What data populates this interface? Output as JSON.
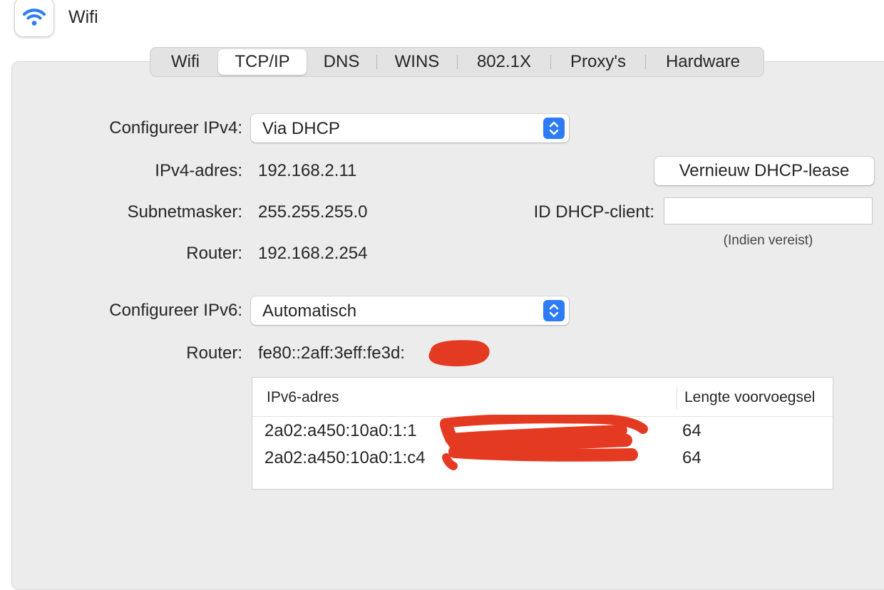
{
  "window": {
    "title": "Wifi",
    "icon": "wifi-icon"
  },
  "tabs": [
    {
      "label": "Wifi",
      "active": false
    },
    {
      "label": "TCP/IP",
      "active": true
    },
    {
      "label": "DNS",
      "active": false
    },
    {
      "label": "WINS",
      "active": false
    },
    {
      "label": "802.1X",
      "active": false
    },
    {
      "label": "Proxy's",
      "active": false
    },
    {
      "label": "Hardware",
      "active": false
    }
  ],
  "ipv4": {
    "configure_label": "Configureer IPv4:",
    "configure_value": "Via DHCP",
    "address_label": "IPv4-adres:",
    "address_value": "192.168.2.11",
    "subnet_label": "Subnetmasker:",
    "subnet_value": "255.255.255.0",
    "router_label": "Router:",
    "router_value": "192.168.2.254"
  },
  "dhcp": {
    "renew_button": "Vernieuw DHCP-lease",
    "client_id_label": "ID DHCP-client:",
    "client_id_value": "",
    "client_id_hint": "(Indien vereist)"
  },
  "ipv6": {
    "configure_label": "Configureer IPv6:",
    "configure_value": "Automatisch",
    "router_label": "Router:",
    "router_value": "fe80::2aff:3eff:fe3d:",
    "table": {
      "headers": [
        "IPv6-adres",
        "Lengte voorvoegsel"
      ],
      "rows": [
        {
          "address": "2a02:a450:10a0:1:1",
          "prefix": "64"
        },
        {
          "address": "2a02:a450:10a0:1:c4",
          "prefix": "64"
        }
      ]
    }
  },
  "colors": {
    "accent": "#2d7cf6",
    "redaction": "#e53a22",
    "panel": "#ececec"
  }
}
